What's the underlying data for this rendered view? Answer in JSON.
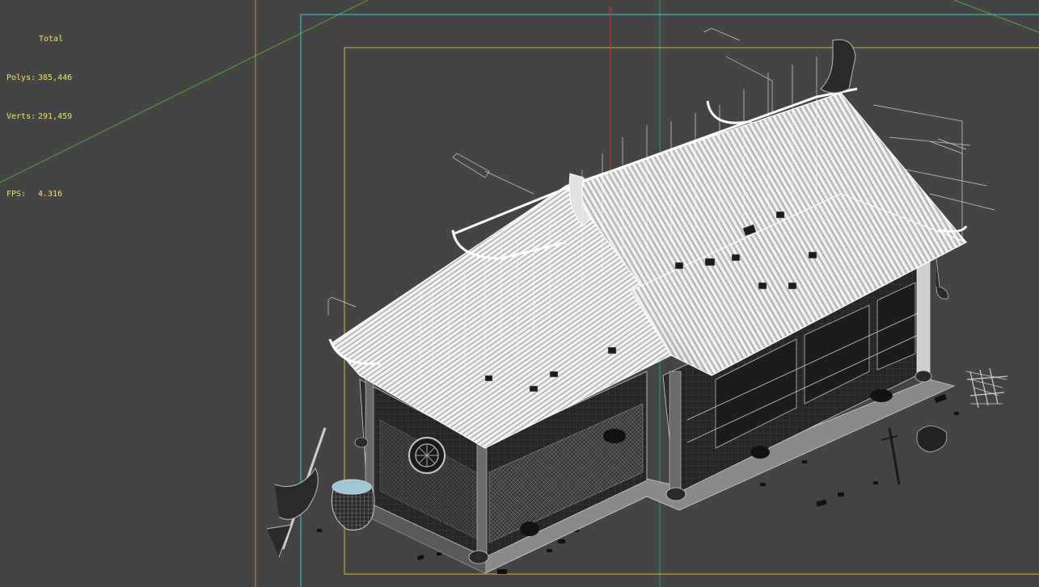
{
  "stats": {
    "header": "Total",
    "polys_label": "Polys:",
    "polys_value": "385,446",
    "verts_label": "Verts:",
    "verts_value": "291,459",
    "fps_label": "FPS:",
    "fps_value": "4.316"
  },
  "gizmo": {
    "y_axis_label": "y"
  },
  "colors": {
    "background": "#444444",
    "stats_text": "#f0e36a",
    "safe_frame_outer": "#39c7d3",
    "safe_frame_inner": "#d9b43a",
    "grid_green": "#5aa03a",
    "wireframe": "#ffffff",
    "y_axis": "#d23030"
  }
}
